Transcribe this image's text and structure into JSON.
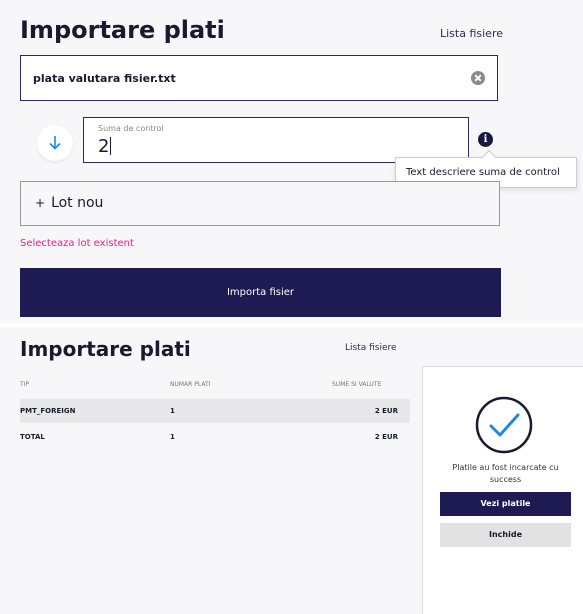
{
  "top": {
    "title": "Importare plati",
    "files_link": "Lista fisiere",
    "file_name": "plata valutara fisier.txt",
    "checksum_label": "Suma de control",
    "checksum_value": "2",
    "tooltip": "Text descriere suma de control",
    "new_lot": "Lot nou",
    "select_existing": "Selecteaza lot existent",
    "import_button": "Importa fisier"
  },
  "bottom": {
    "title": "Importare plati",
    "files_link": "Lista fisiere",
    "table": {
      "headers": [
        "TIP",
        "NUMAR PLATI",
        "SUME SI VALUTE"
      ],
      "rows": [
        [
          "PMT_FOREIGN",
          "1",
          "2 EUR"
        ],
        [
          "TOTAL",
          "1",
          "2 EUR"
        ]
      ]
    },
    "modal": {
      "message": "Platile au fost incarcate cu success",
      "view_button": "Vezi platile",
      "close_button": "Inchide"
    }
  },
  "colors": {
    "primary": "#1e1a52",
    "accent": "#e0218a",
    "success_check": "#1e88e5"
  },
  "icons": [
    "clear-icon",
    "arrow-down-icon",
    "info-icon",
    "plus-icon",
    "checkmark-circle-icon"
  ]
}
